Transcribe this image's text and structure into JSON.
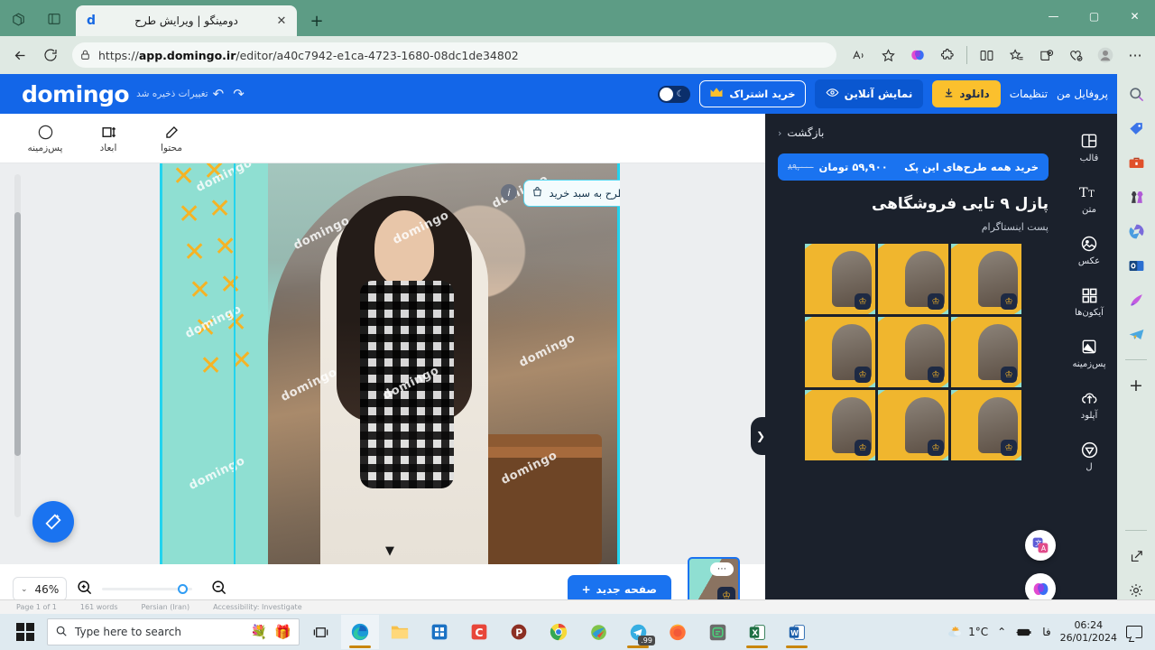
{
  "browser": {
    "tab": {
      "title": "دومینگو | ویرایش طرح",
      "favicon": "d",
      "close": "✕"
    },
    "newtab_label": "+",
    "toolbar_icons": {
      "collections": "collections-icon",
      "split_screen": "split-screen-icon",
      "back": "←",
      "refresh": "⟳",
      "lock": "🔒",
      "read_aloud": "read-aloud-icon",
      "favorite": "☆",
      "copilot": "copilot-icon",
      "extensions": "extensions-icon",
      "browser_essentials": "browser-essentials-icon",
      "favorites_list": "favorites-icon",
      "collections2": "collections-add-icon",
      "profile": "profile-icon",
      "settings_more": "···"
    },
    "url_prefix": "https://",
    "url_domain": "app.domingo.ir",
    "url_path": "/editor/a40c7942-e1ca-4723-1680-08dc1de34802",
    "window_controls": {
      "minimize": "—",
      "maximize": "▢",
      "close": "✕"
    }
  },
  "edge_sidebar": {
    "items": [
      {
        "name": "search-icon",
        "glyph": "🔍"
      },
      {
        "name": "shopping-tag-icon",
        "glyph": "🏷"
      },
      {
        "name": "tools-icon",
        "glyph": "🧰"
      },
      {
        "name": "games-icon",
        "glyph": "♟"
      },
      {
        "name": "microsoft-365-icon",
        "glyph": "🌀"
      },
      {
        "name": "outlook-icon",
        "glyph": "📧"
      },
      {
        "name": "designer-icon",
        "glyph": "🎨"
      },
      {
        "name": "telegram-web-icon",
        "glyph": "✈"
      },
      {
        "name": "add-sidebar-app-icon",
        "glyph": "+"
      },
      {
        "name": "open-in-new-window-icon",
        "glyph": "⧉"
      },
      {
        "name": "sidebar-settings-icon",
        "glyph": "⚙"
      }
    ]
  },
  "app": {
    "brand": "domingo",
    "saved_status": "تغییرات ذخیره شد",
    "undo_icon": "↶",
    "redo_icon": "↷",
    "header": {
      "profile": "پروفایل من",
      "settings": "تنظیمات",
      "download": "دانلود",
      "download_icon": "⬇",
      "preview": "نمایش آنلاین",
      "preview_icon": "👁",
      "subscribe": "خرید اشتراک",
      "subscribe_icon": "👑",
      "dark_toggle_icon": "☾"
    },
    "editor_toolbar": [
      {
        "label": "محتوا",
        "icon": "✎",
        "name": "content"
      },
      {
        "label": "ابعاد",
        "icon": "⇳",
        "name": "dimensions"
      },
      {
        "label": "پس‌زمینه",
        "icon": "◯",
        "name": "background"
      }
    ],
    "canvas": {
      "watermark": "domingo",
      "add_to_cart": "افزودن طرح به سبد خرید",
      "cart_icon": "🛍",
      "info_badge": "i",
      "magic_icon": "✨",
      "collapse_icon": "▼"
    },
    "footer": {
      "zoom_value": "46%",
      "zoom_chevron": "⌄",
      "zoom_in_icon": "⊕",
      "zoom_out_icon": "⊖",
      "new_page": "صفحه جدید",
      "new_page_icon": "+",
      "page_number": "1",
      "thumb_menu": "⋯",
      "thumb_crown": "♔"
    },
    "right_panel": {
      "back": "بازگشت",
      "back_chevron": "‹",
      "buy_pack_label": "خرید همه طرح‌های این پک",
      "price_old": "۸۹,۰۰۰",
      "price_new": "۵۹,۹۰۰ تومان",
      "pack_title": "پازل ۹ تایی فروشگاهی",
      "pack_subtitle": "پست اینستاگرام",
      "crown_icon": "♔",
      "thumbnails": [
        {
          "id": 1
        },
        {
          "id": 2
        },
        {
          "id": 3
        },
        {
          "id": 4
        },
        {
          "id": 5
        },
        {
          "id": 6
        },
        {
          "id": 7
        },
        {
          "id": 8
        },
        {
          "id": 9
        }
      ],
      "panel_handle_icon": "❯"
    },
    "rail": [
      {
        "label": "قالب",
        "icon": "▦",
        "name": "template"
      },
      {
        "label": "متن",
        "icon": "T",
        "name": "text"
      },
      {
        "label": "عکس",
        "icon": "🖼",
        "name": "image"
      },
      {
        "label": "آیکون‌ها",
        "icon": "▪▪",
        "name": "icons"
      },
      {
        "label": "پس‌زمینه",
        "icon": "◩",
        "name": "background"
      },
      {
        "label": "آپلود",
        "icon": "⛅",
        "name": "upload"
      },
      {
        "label": "ل",
        "icon": "▽",
        "name": "shapes"
      }
    ],
    "float_icons": [
      {
        "name": "translate-icon",
        "glyph": "文"
      },
      {
        "name": "copilot-icon",
        "glyph": "🧠"
      }
    ]
  },
  "taskbar": {
    "search_placeholder": "Type here to search",
    "search_icon": "🔎",
    "decor_icons": [
      "💐",
      "🎁"
    ],
    "task_view_icon": "❐",
    "apps": [
      {
        "name": "edge",
        "glyph": "🌐",
        "active": true,
        "badge": ""
      },
      {
        "name": "file-explorer",
        "glyph": "📁",
        "active": false,
        "badge": ""
      },
      {
        "name": "microsoft-store",
        "glyph": "🛍",
        "active": false,
        "badge": ""
      },
      {
        "name": "c-app",
        "glyph": "C",
        "active": false,
        "badge": ""
      },
      {
        "name": "p-app",
        "glyph": "P",
        "active": false,
        "badge": ""
      },
      {
        "name": "chrome",
        "glyph": "◉",
        "active": false,
        "badge": ""
      },
      {
        "name": "internet-download-manager",
        "glyph": "⬇",
        "active": false,
        "badge": ""
      },
      {
        "name": "telegram",
        "glyph": "✈",
        "active": true,
        "badge": ".99"
      },
      {
        "name": "firefox",
        "glyph": "🦊",
        "active": false,
        "badge": ""
      },
      {
        "name": "green-app",
        "glyph": "▤",
        "active": false,
        "badge": ""
      },
      {
        "name": "excel",
        "glyph": "X",
        "active": true,
        "badge": ""
      },
      {
        "name": "word",
        "glyph": "W",
        "active": true,
        "badge": ""
      }
    ],
    "tray": {
      "weather_icon": "⛅",
      "temperature": "1°C",
      "chevron": "⌃",
      "battery_icon": "🔋",
      "language": "فا",
      "time": "06:24",
      "date": "26/01/2024"
    }
  }
}
